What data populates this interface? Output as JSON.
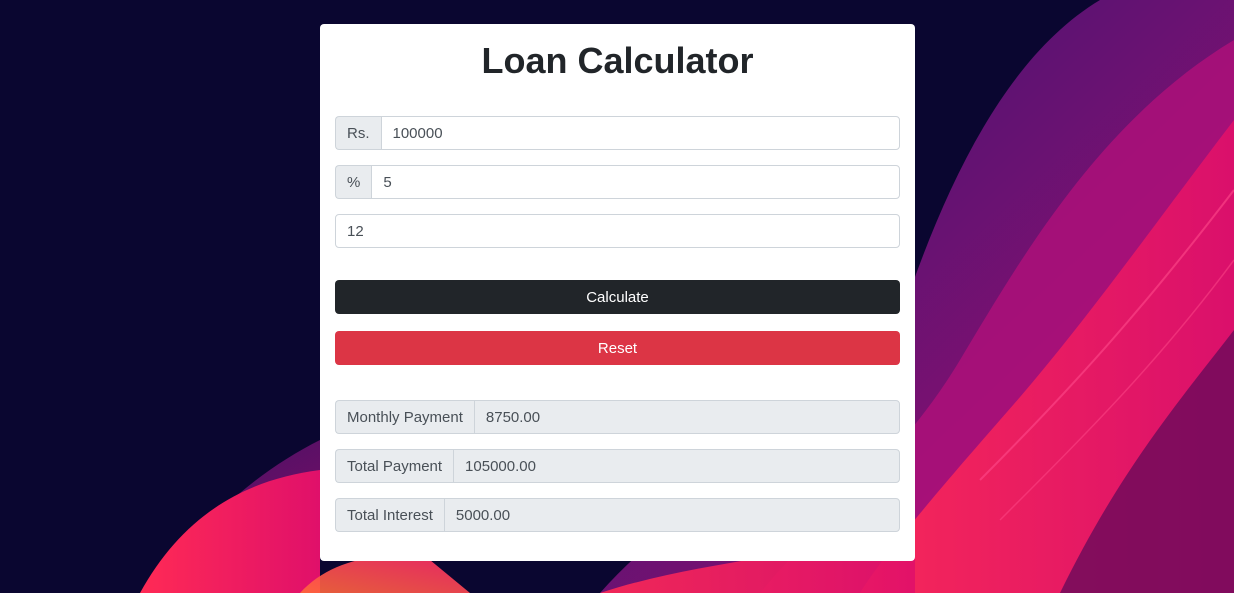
{
  "app": {
    "title": "Loan Calculator"
  },
  "form": {
    "amount": {
      "prefix": "Rs.",
      "value": "100000"
    },
    "interest": {
      "prefix": "%",
      "value": "5"
    },
    "years": {
      "value": "12"
    }
  },
  "buttons": {
    "calculate_label": "Calculate",
    "reset_label": "Reset"
  },
  "results": {
    "monthly_payment": {
      "label": "Monthly Payment",
      "value": "8750.00"
    },
    "total_payment": {
      "label": "Total Payment",
      "value": "105000.00"
    },
    "total_interest": {
      "label": "Total Interest",
      "value": "5000.00"
    }
  },
  "colors": {
    "calculate_button": "#212529",
    "reset_button": "#dc3545",
    "background": "#0a0630"
  }
}
